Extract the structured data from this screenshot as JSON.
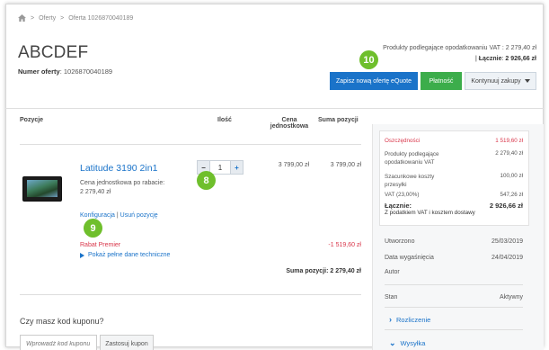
{
  "breadcrumb": {
    "home_icon": "home-icon",
    "sep": ">",
    "items": [
      "Oferty",
      "Oferta 1026870040189"
    ]
  },
  "header": {
    "title": "ABCDEF",
    "offer_number_label": "Numer oferty",
    "offer_number_value": "1026870040189",
    "vat_text": "Produkty podlegające opodatkowaniu VAT : 2 279,40 zł",
    "total_label": "Łącznie",
    "total_value": "2 926,66 zł"
  },
  "toolbar": {
    "save_label": "Zapisz nową ofertę eQuote",
    "pay_label": "Płatność",
    "continue_label": "Kontynuuj zakupy"
  },
  "annotations": {
    "b10": "10",
    "b8": "8",
    "b9": "9",
    "color": "#6fbf2c"
  },
  "columns": {
    "items": "Pozycje",
    "qty": "Ilość",
    "unit_price_1": "Cena",
    "unit_price_2": "jednostkowa",
    "line_total": "Suma pozycji"
  },
  "product": {
    "name": "Latitude 3190 2in1",
    "discount_label": "Cena jednostkowa po rabacie:",
    "discount_price": "2 279,40 zł",
    "config_link": "Konfiguracja",
    "link_sep": "|",
    "remove_link": "Usuń pozycję",
    "qty_minus": "−",
    "qty_value": "1",
    "qty_plus": "+",
    "unit_price": "3 799,00 zł",
    "line_total": "3 799,00 zł",
    "promo_label": "Rabat Premier",
    "promo_value": "-1 519,60 zł",
    "specs_link": "Pokaż pełne dane techniczne",
    "subtotal": "Suma pozycji: 2 279,40 zł"
  },
  "summary": {
    "savings_label": "Oszczędności",
    "savings_value": "1 519,60 zł",
    "vat_products_label": "Produkty podlegające opodatkowaniu VAT",
    "vat_products_value": "2 279,40 zł",
    "shipping_label": "Szacunkowe koszty przesyłki",
    "shipping_value": "100,00 zł",
    "vat_label": "VAT (23,00%)",
    "vat_value": "547,26 zł",
    "total_label": "Łącznie:",
    "total_note": "Z podatkiem VAT i kosztem dostawy",
    "total_value": "2 926,66 zł"
  },
  "details": {
    "created_label": "Utworzono",
    "created_value": "25/03/2019",
    "expires_label": "Data wygaśnięcia",
    "expires_value": "24/04/2019",
    "author_label": "Autor",
    "status_label": "Stan",
    "status_value": "Aktywny",
    "billing_link": "Rozliczenie",
    "shipping_link": "Wysyłka"
  },
  "coupon": {
    "question": "Czy masz kod kuponu?",
    "placeholder": "Wprowadź kod kuponu",
    "apply_label": "Zastosuj kupon"
  }
}
